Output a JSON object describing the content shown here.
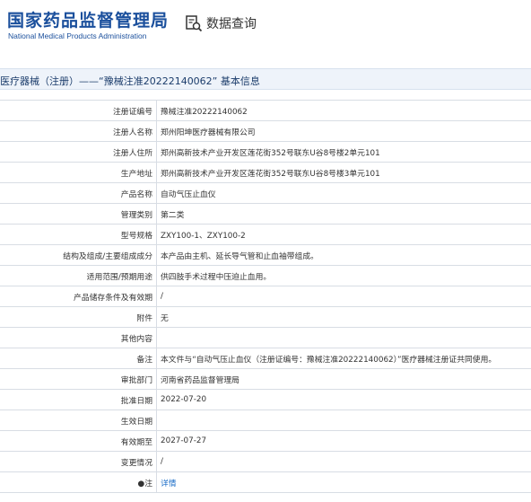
{
  "header": {
    "logo_cn": "国家药品监督管理局",
    "logo_en": "National Medical Products Administration",
    "query_label": "数据查询",
    "query_icon": "magnifier-document-icon"
  },
  "title": "医疗器械（注册）——“豫械注准20222140062” 基本信息",
  "colors": {
    "brand": "#1a4f9c",
    "title_bar": "#eef3fa",
    "link": "#1a6cc7"
  },
  "rows": [
    {
      "label": "注册证编号",
      "value": "豫械注准20222140062"
    },
    {
      "label": "注册人名称",
      "value": "郑州阳坤医疗器械有限公司"
    },
    {
      "label": "注册人住所",
      "value": "郑州高新技术产业开发区莲花街352号联东U谷8号楼2单元101"
    },
    {
      "label": "生产地址",
      "value": "郑州高新技术产业开发区莲花街352号联东U谷8号楼3单元101"
    },
    {
      "label": "产品名称",
      "value": "自动气压止血仪"
    },
    {
      "label": "管理类别",
      "value": "第二类"
    },
    {
      "label": "型号规格",
      "value": "ZXY100-1、ZXY100-2"
    },
    {
      "label": "结构及组成/主要组成成分",
      "value": "本产品由主机、延长导气管和止血袖带组成。"
    },
    {
      "label": "适用范围/预期用途",
      "value": "供四肢手术过程中压迫止血用。"
    },
    {
      "label": "产品储存条件及有效期",
      "value": "/"
    },
    {
      "label": "附件",
      "value": "无"
    },
    {
      "label": "其他内容",
      "value": ""
    },
    {
      "label": "备注",
      "value": "本文件与“自动气压止血仪（注册证编号：豫械注准20222140062）”医疗器械注册证共同使用。"
    },
    {
      "label": "审批部门",
      "value": "河南省药品监督管理局"
    },
    {
      "label": "批准日期",
      "value": "2022-07-20"
    },
    {
      "label": "生效日期",
      "value": ""
    },
    {
      "label": "有效期至",
      "value": "2027-07-27"
    },
    {
      "label": "变更情况",
      "value": "/"
    },
    {
      "label": "●注",
      "value": "详情"
    }
  ]
}
